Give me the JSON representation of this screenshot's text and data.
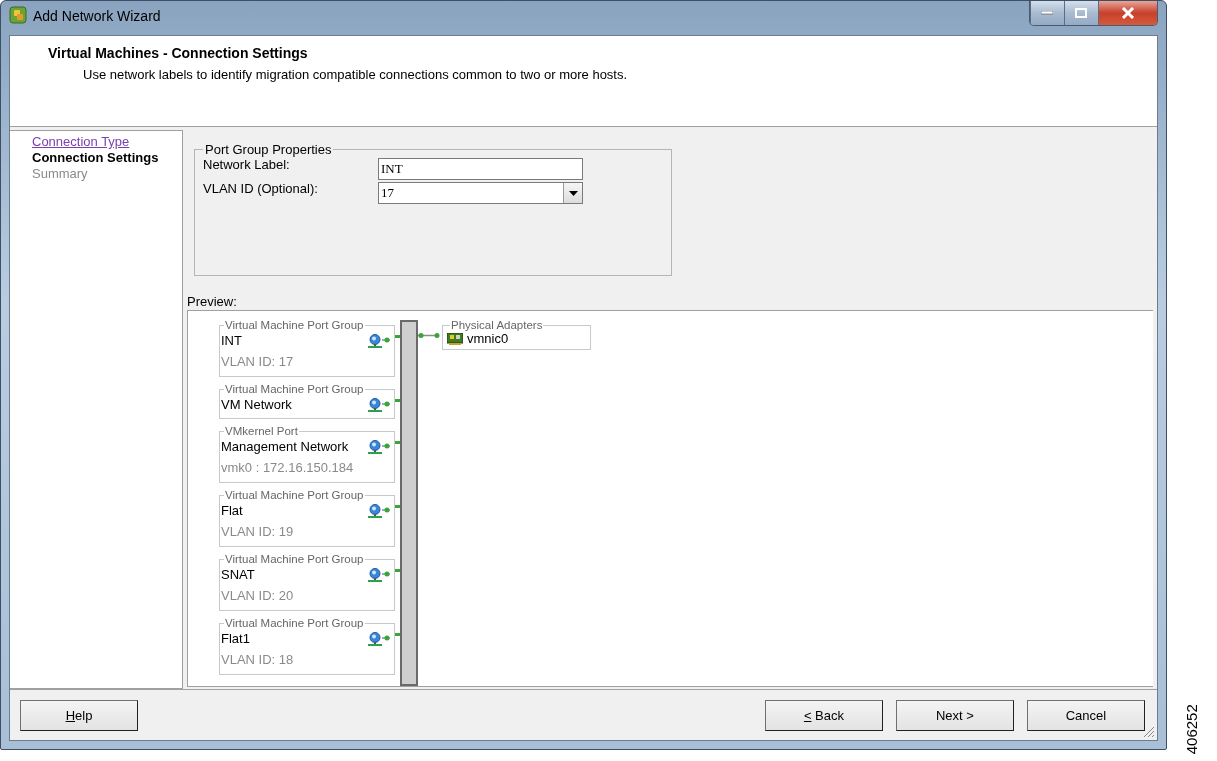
{
  "window": {
    "title": "Add Network Wizard"
  },
  "header": {
    "title": "Virtual Machines - Connection Settings",
    "description": "Use network labels to identify migration compatible connections common to two or more hosts."
  },
  "steps": [
    {
      "label": "Connection Type",
      "visited": true,
      "selected": false
    },
    {
      "label": "Connection Settings",
      "visited": false,
      "selected": true
    },
    {
      "label": "Summary",
      "visited": false,
      "selected": false
    }
  ],
  "port_group_properties": {
    "title": "Port Group Properties",
    "fields": [
      {
        "kind": "text",
        "label": "Network Label:",
        "value": "INT"
      },
      {
        "kind": "combo",
        "label": "VLAN ID (Optional):",
        "value": "17"
      }
    ]
  },
  "preview": {
    "label": "Preview:",
    "port_groups": [
      {
        "type": "Virtual Machine Port Group",
        "name": "INT",
        "detail": "VLAN ID: 17"
      },
      {
        "type": "Virtual Machine Port Group",
        "name": "VM Network"
      },
      {
        "type": "VMkernel Port",
        "name": "Management Network",
        "detail": "vmk0 : 172.16.150.184"
      },
      {
        "type": "Virtual Machine Port Group",
        "name": "Flat",
        "detail": "VLAN ID: 19"
      },
      {
        "type": "Virtual Machine Port Group",
        "name": "SNAT",
        "detail": "VLAN ID: 20"
      },
      {
        "type": "Virtual Machine Port Group",
        "name": "Flat1",
        "detail": "VLAN ID: 18"
      }
    ],
    "adapters": {
      "title": "Physical Adapters",
      "items": [
        "vmnic0"
      ]
    }
  },
  "buttons": [
    {
      "label": "Help",
      "underline_first": true
    },
    {
      "label": "< Back",
      "underline_first": true
    },
    {
      "label": "Next >",
      "underline_first": false
    },
    {
      "label": "Cancel",
      "underline_first": false
    }
  ],
  "figure_number": "406252"
}
